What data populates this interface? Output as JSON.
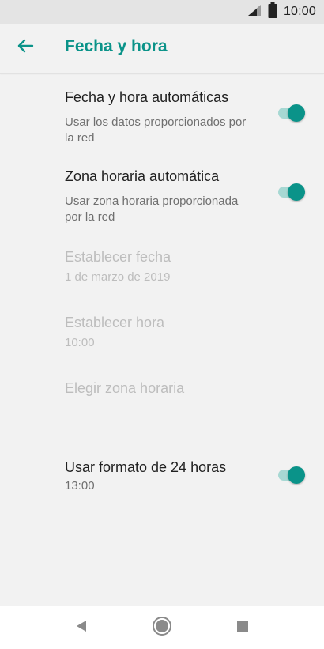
{
  "status_bar": {
    "time": "10:00",
    "signal_icon": "cell-signal-icon",
    "battery_icon": "battery-full-icon"
  },
  "app_bar": {
    "back_icon": "arrow-back-icon",
    "title": "Fecha y hora"
  },
  "settings": [
    {
      "title": "Fecha y hora automáticas",
      "summary": "Usar los datos proporcionados por la red",
      "toggle": true,
      "enabled": true
    },
    {
      "title": "Zona horaria automática",
      "summary": "Usar zona horaria proporcionada por la red",
      "toggle": true,
      "enabled": true
    },
    {
      "title": "Establecer fecha",
      "summary": "1 de marzo de 2019",
      "enabled": false
    },
    {
      "title": "Establecer hora",
      "summary": "10:00",
      "enabled": false
    },
    {
      "title": "Elegir zona horaria",
      "enabled": false
    },
    {
      "title": "Usar formato de 24 horas",
      "summary": "13:00",
      "toggle": true,
      "enabled": true
    }
  ],
  "nav_bar": {
    "back_icon": "nav-back-triangle-icon",
    "home_icon": "nav-home-circle-icon",
    "recents_icon": "nav-recents-square-icon"
  },
  "colors": {
    "accent": "#0a9389",
    "toggle_track": "#a7d8d3",
    "background": "#f2f2f2",
    "status_bar": "#e4e4e4",
    "disabled_text": "#bdbdbd"
  }
}
